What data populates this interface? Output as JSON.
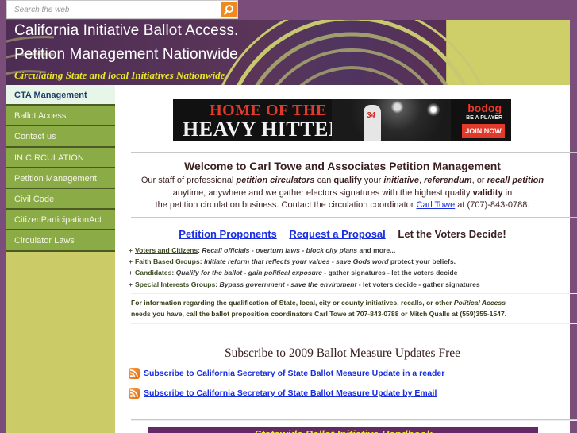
{
  "search": {
    "placeholder": "Search the web",
    "button_icon": "search-icon"
  },
  "header": {
    "title_line1": "California Initiative Ballot Access.",
    "title_line2": "Petition Management Nationwide",
    "tagline": "Circulating State and local Initiatives Nationwide"
  },
  "sidebar": {
    "items": [
      {
        "label": "CTA Management",
        "active": true
      },
      {
        "label": "Ballot Access"
      },
      {
        "label": "Contact us"
      },
      {
        "label": "IN CIRCULATION"
      },
      {
        "label": "Petition Management"
      },
      {
        "label": "Civil Code"
      },
      {
        "label": "CitizenParticipationAct"
      },
      {
        "label": "Circulator Laws"
      }
    ]
  },
  "ad": {
    "headline1": "HOME OF THE",
    "headline2": "HEAVY HITTERS",
    "jersey_number": "34",
    "brand": "bodog",
    "slogan": "BE A PLAYER",
    "cta": "JOIN NOW"
  },
  "welcome": {
    "title": "Welcome to Carl Towe and Associates Petition Management",
    "p1": "Our staff of professional ",
    "p1_em": "petition circulators",
    "p2": " can ",
    "p2_b": "qualify",
    "p3": " your ",
    "p3_em": "initiative",
    "p4": ", ",
    "p4_em": "referendum",
    "p5": ", or ",
    "p5_em": "recall petition",
    "p6": "anytime, anywhere and we gather electors signatures with the highest quality ",
    "p6_b": "validity",
    "p7": " in",
    "p8": "the petition circulation business. Contact the circulation coordinator ",
    "contact_link": "Carl Towe",
    "p9": " at (707)-843-0788."
  },
  "cta_row": {
    "link1": "Petition Proponents",
    "link2": "Request a Proposal",
    "text": "Let the Voters Decide!"
  },
  "bullets": [
    {
      "link": "Voters and Citizens",
      "sep": ": ",
      "em": "Recall officials - overturn laws - block city plans",
      "rest": " and more..."
    },
    {
      "link": "Faith Based Groups",
      "sep": ": ",
      "em": "Initiate reform that reflects your values - save Gods word",
      "rest": "  protect your beliefs."
    },
    {
      "link": "Candidates",
      "sep": ": ",
      "em": "Qualify for the ballot - gain political exposure",
      "rest": " - gather signatures - let the voters decide"
    },
    {
      "link": "Special Interests Groups",
      "sep": ": ",
      "em": "Bypass government  - save the enviroment",
      "rest": " - let voters decide - gather signatures"
    }
  ],
  "info": {
    "line1": " For information regarding the qualification of State, local, city or county initiatives, recalls, or other ",
    "line1_em": "Political Access",
    "line2": "needs you have, call the ballot proposition coordinators Carl Towe at 707-843-0788 or Mitch Qualls at (559)355-1547."
  },
  "subscribe": {
    "title": "Subscribe to 2009 Ballot Measure Updates Free",
    "links": [
      {
        "icon": "rss-icon",
        "label": "Subscribe to California Secretary of State Ballot Measure Update in a reader"
      },
      {
        "icon": "rss-icon",
        "label": "Subscribe to California Secretary of State Ballot Measure Update by Email"
      }
    ]
  },
  "handbook": {
    "title": "Statewide Ballot Initiative Handbook"
  },
  "colors": {
    "page_bg": "#7a4d7a",
    "header_purple": "#4e2d55",
    "accent_lime": "#cbcb68",
    "nav_green": "#8aab45",
    "tagline_yellow": "#e8e828",
    "link_blue": "#1a2ee0",
    "search_orange": "#f08a1e"
  }
}
